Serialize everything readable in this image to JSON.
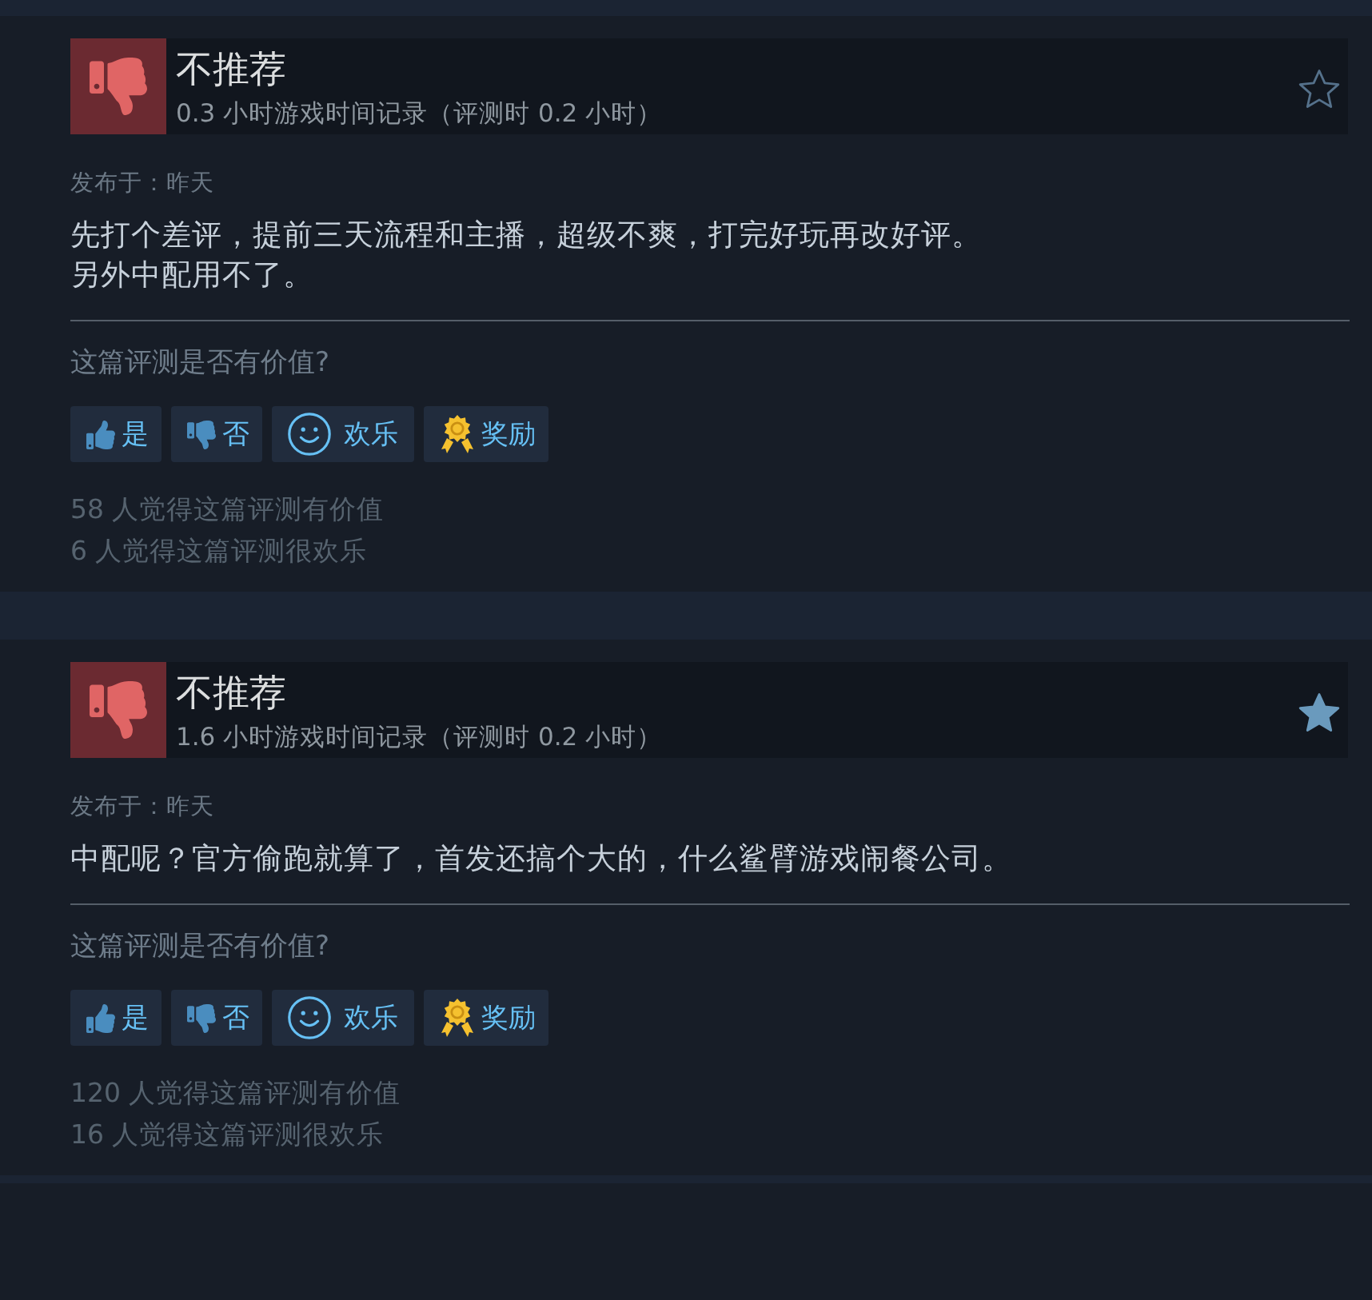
{
  "reviews": [
    {
      "recommended": false,
      "verdict": "不推荐",
      "playtime": "0.3 小时游戏时间记录（评测时 0.2 小时）",
      "starred": false,
      "posted": "发布于：昨天",
      "body": [
        "先打个差评，提前三天流程和主播，超级不爽，打完好玩再改好评。",
        "另外中配用不了。"
      ],
      "question": "这篇评测是否有价值?",
      "buttons": [
        {
          "kind": "yes",
          "label": "是"
        },
        {
          "kind": "no",
          "label": "否"
        },
        {
          "kind": "funny",
          "label": "欢乐"
        },
        {
          "kind": "award",
          "label": "奖励"
        }
      ],
      "counts": [
        "58 人觉得这篇评测有价值",
        "6 人觉得这篇评测很欢乐"
      ]
    },
    {
      "recommended": false,
      "verdict": "不推荐",
      "playtime": "1.6 小时游戏时间记录（评测时 0.2 小时）",
      "starred": true,
      "posted": "发布于：昨天",
      "body": [
        "中配呢？官方偷跑就算了，首发还搞个大的，什么鲨臂游戏闹餐公司。"
      ],
      "question": "这篇评测是否有价值?",
      "buttons": [
        {
          "kind": "yes",
          "label": "是"
        },
        {
          "kind": "no",
          "label": "否"
        },
        {
          "kind": "funny",
          "label": "欢乐"
        },
        {
          "kind": "award",
          "label": "奖励"
        }
      ],
      "counts": [
        "120 人觉得这篇评测有价值",
        "16 人觉得这篇评测很欢乐"
      ]
    }
  ]
}
